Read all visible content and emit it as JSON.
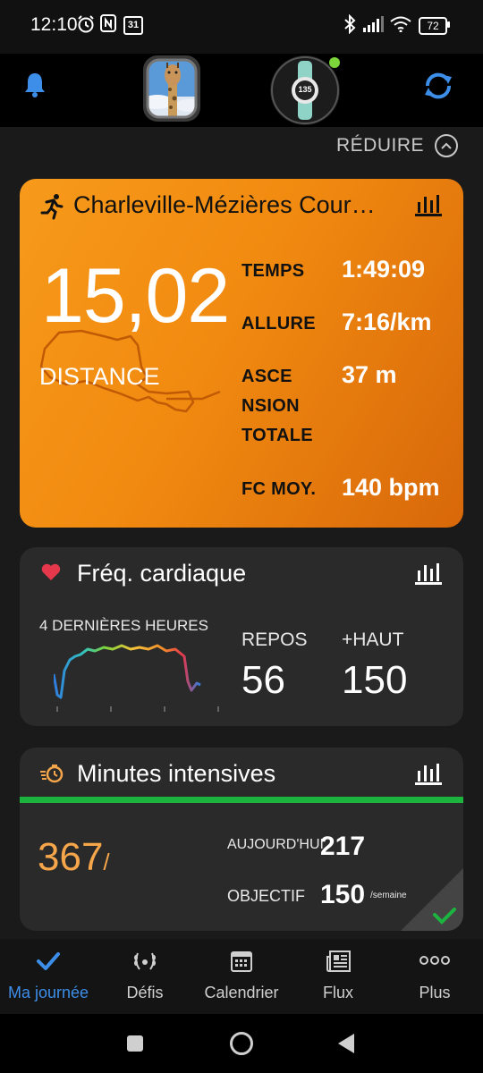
{
  "status_bar": {
    "time": "12:10",
    "calendar_day": "31",
    "battery": "72",
    "icons": [
      "alarm-icon",
      "nfc-icon",
      "calendar-icon",
      "bluetooth-icon",
      "signal-icon",
      "wifi-icon",
      "battery-icon"
    ]
  },
  "header": {
    "notification_icon": "bell-icon",
    "avatar_alt": "giraffe-avatar",
    "device_screen": "135",
    "sync_icon": "sync-icon"
  },
  "reduce": {
    "label": "RÉDUIRE"
  },
  "activity_card": {
    "title": "Charleville-Mézières Cour…",
    "big_value": "15,02",
    "big_label": "DISTANCE",
    "stats": [
      {
        "label": "TEMPS",
        "value": "1:49:09"
      },
      {
        "label": "ALLURE",
        "value": "7:16/km"
      },
      {
        "label_lines": [
          "ASCE",
          "NSION",
          "TOTALE"
        ],
        "value": "37 m"
      },
      {
        "label": "FC MOY.",
        "value": "140 bpm"
      }
    ],
    "accent": "#f18a10"
  },
  "heart_card": {
    "title": "Fréq. cardiaque",
    "chart_label": "4 DERNIÈRES HEURES",
    "resting_label": "REPOS",
    "resting_value": "56",
    "high_label": "+HAUT",
    "high_value": "150",
    "heart_color": "#e5384b"
  },
  "intensity_card": {
    "title": "Minutes intensives",
    "total": "367",
    "slash": "/",
    "today_label": "AUJOURD'HUI",
    "today_value": "217",
    "goal_label": "OBJECTIF",
    "goal_value": "150",
    "goal_unit": "/semaine",
    "accent": "#f5a54a",
    "bar_color": "#1db33f"
  },
  "bottom_nav": [
    {
      "label": "Ma journée",
      "icon": "check-icon",
      "active": true
    },
    {
      "label": "Défis",
      "icon": "laurel-icon",
      "active": false
    },
    {
      "label": "Calendrier",
      "icon": "calendar-grid-icon",
      "active": false
    },
    {
      "label": "Flux",
      "icon": "newspaper-icon",
      "active": false
    },
    {
      "label": "Plus",
      "icon": "more-dots-icon",
      "active": false
    }
  ],
  "active_color": "#3d8ee8"
}
